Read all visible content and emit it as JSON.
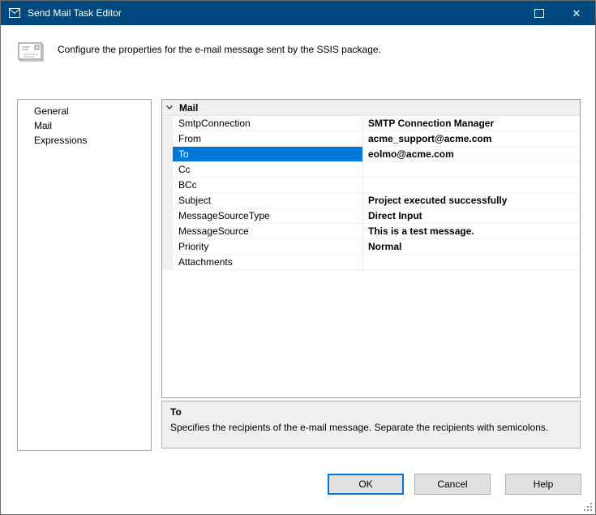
{
  "window": {
    "title": "Send Mail Task Editor",
    "close_glyph": "✕"
  },
  "header": {
    "description": "Configure the properties for the e-mail message sent by the SSIS package."
  },
  "nav": {
    "items": [
      {
        "label": "General"
      },
      {
        "label": "Mail"
      },
      {
        "label": "Expressions"
      }
    ]
  },
  "property_grid": {
    "category": "Mail",
    "rows": [
      {
        "name": "SmtpConnection",
        "value": "SMTP Connection Manager"
      },
      {
        "name": "From",
        "value": "acme_support@acme.com"
      },
      {
        "name": "To",
        "value": "eolmo@acme.com"
      },
      {
        "name": "Cc",
        "value": ""
      },
      {
        "name": "BCc",
        "value": ""
      },
      {
        "name": "Subject",
        "value": "Project executed successfully"
      },
      {
        "name": "MessageSourceType",
        "value": "Direct Input"
      },
      {
        "name": "MessageSource",
        "value": "This is a test message."
      },
      {
        "name": "Priority",
        "value": "Normal"
      },
      {
        "name": "Attachments",
        "value": ""
      }
    ],
    "selected_row": "To"
  },
  "description_panel": {
    "title": "To",
    "text": "Specifies the recipients of the e-mail message. Separate the recipients with semicolons."
  },
  "buttons": {
    "ok": "OK",
    "cancel": "Cancel",
    "help": "Help"
  },
  "colors": {
    "titlebar": "#00497e",
    "selection": "#0078d7",
    "focused_button_border": "#0078d7",
    "panel_background": "#f0f0f0"
  }
}
